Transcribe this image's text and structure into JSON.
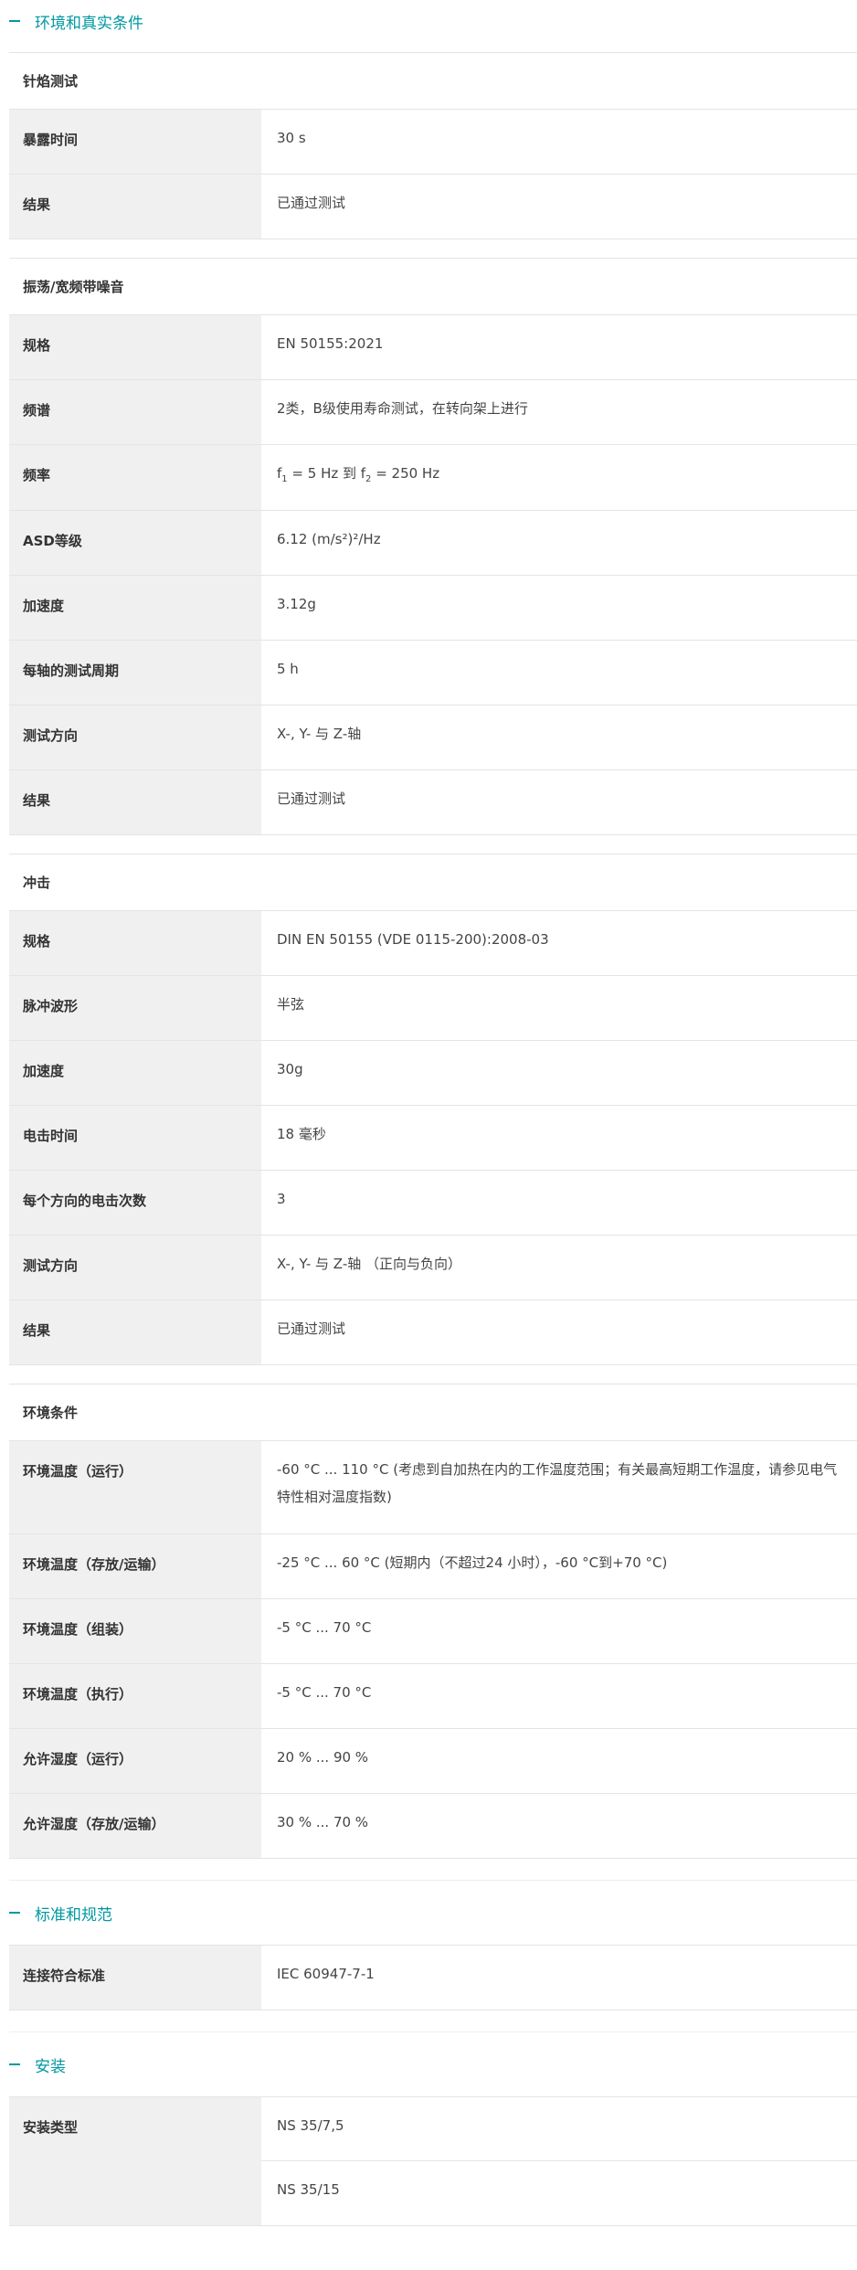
{
  "sections": [
    {
      "title": "环境和真实条件",
      "groups": [
        {
          "title": "针焰测试",
          "rows": [
            {
              "k": "暴露时间",
              "v": "30 s"
            },
            {
              "k": "结果",
              "v": "已通过测试"
            }
          ]
        },
        {
          "title": "振荡/宽频带噪音",
          "rows": [
            {
              "k": "规格",
              "v": "EN 50155:2021"
            },
            {
              "k": "频谱",
              "v": "2类，B级使用寿命测试，在转向架上进行"
            },
            {
              "k": "频率",
              "v_pre": "f",
              "v_sub1": "1",
              "v_mid": " = 5 Hz 到 f",
              "v_sub2": "2",
              "v_post": " = 250 Hz"
            },
            {
              "k": "ASD等级",
              "v": "6.12 (m/s²)²/Hz"
            },
            {
              "k": "加速度",
              "v": "3.12g"
            },
            {
              "k": "每轴的测试周期",
              "v": "5 h"
            },
            {
              "k": "测试方向",
              "v": "X-, Y- 与 Z-轴"
            },
            {
              "k": "结果",
              "v": "已通过测试"
            }
          ]
        },
        {
          "title": "冲击",
          "rows": [
            {
              "k": "规格",
              "v": "DIN EN 50155 (VDE 0115-200):2008-03"
            },
            {
              "k": "脉冲波形",
              "v": "半弦"
            },
            {
              "k": "加速度",
              "v": "30g"
            },
            {
              "k": "电击时间",
              "v": "18 毫秒"
            },
            {
              "k": "每个方向的电击次数",
              "v": "3"
            },
            {
              "k": "测试方向",
              "v": "X-, Y- 与 Z-轴 （正向与负向）"
            },
            {
              "k": "结果",
              "v": "已通过测试"
            }
          ]
        },
        {
          "title": "环境条件",
          "rows": [
            {
              "k": "环境温度（运行）",
              "v": "-60 °C ... 110 °C (考虑到自加热在内的工作温度范围；有关最高短期工作温度，请参见电气特性相对温度指数)"
            },
            {
              "k": "环境温度（存放/运输）",
              "v": "-25 °C ... 60 °C (短期内（不超过24 小时），-60 °C到+70 °C)"
            },
            {
              "k": "环境温度（组装）",
              "v": "-5 °C ... 70 °C"
            },
            {
              "k": "环境温度（执行）",
              "v": "-5 °C ... 70 °C"
            },
            {
              "k": "允许湿度（运行）",
              "v": "20 % ... 90 %"
            },
            {
              "k": "允许湿度（存放/运输）",
              "v": "30 % ... 70 %"
            }
          ]
        }
      ]
    },
    {
      "title": "标准和规范",
      "rows": [
        {
          "k": "连接符合标准",
          "v": "IEC 60947-7-1"
        }
      ]
    },
    {
      "title": "安装",
      "merged": {
        "k": "安装类型",
        "values": [
          "NS 35/7,5",
          "NS 35/15"
        ]
      }
    }
  ]
}
